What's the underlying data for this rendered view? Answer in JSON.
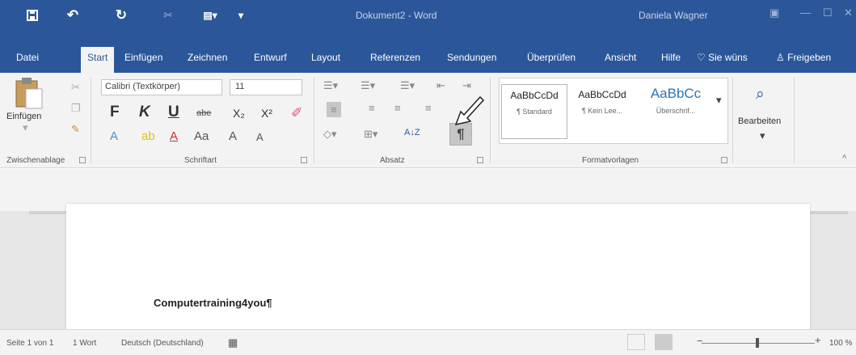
{
  "titlebar": {
    "save_icon": "save-icon",
    "undo_icon": "undo-icon",
    "redo_icon": "redo-icon",
    "title": "Dokument2 - Word",
    "user": "Daniela Wagner"
  },
  "tabs": [
    "Datei",
    "Start",
    "Einfügen",
    "Zeichnen",
    "Entwurf",
    "Layout",
    "Referenzen",
    "Sendungen",
    "Überprüfen",
    "Ansicht",
    "Hilfe",
    "Sie wüns",
    "Freigeben"
  ],
  "clipboard": {
    "paste": "Einfügen",
    "group": "Zwischenablage"
  },
  "font": {
    "name": "Calibri (Textkörper)",
    "size": "11",
    "group": "Schriftart",
    "bold": "F",
    "italic": "K",
    "underline": "U",
    "strike": "abe",
    "subscript": "X₂",
    "superscript": "X²",
    "case": "Aa",
    "grow": "A",
    "shrink": "A"
  },
  "paragraph": {
    "group": "Absatz",
    "pilcrow": "¶",
    "sort": "A↓Z"
  },
  "styles": {
    "group": "Formatvorlagen",
    "items": [
      {
        "sample": "AaBbCcDd",
        "name": "¶ Standard"
      },
      {
        "sample": "AaBbCcDd",
        "name": "¶ Kein Lee..."
      },
      {
        "sample": "AaBbCc",
        "name": "Überschrif..."
      }
    ]
  },
  "editing": {
    "label": "Bearbeiten"
  },
  "document": {
    "text": "Computertraining4you¶"
  },
  "status": {
    "page": "Seite 1 von 1",
    "words": "1 Wort",
    "language": "Deutsch (Deutschland)",
    "zoom": "100 %",
    "zoom_level": 100
  }
}
